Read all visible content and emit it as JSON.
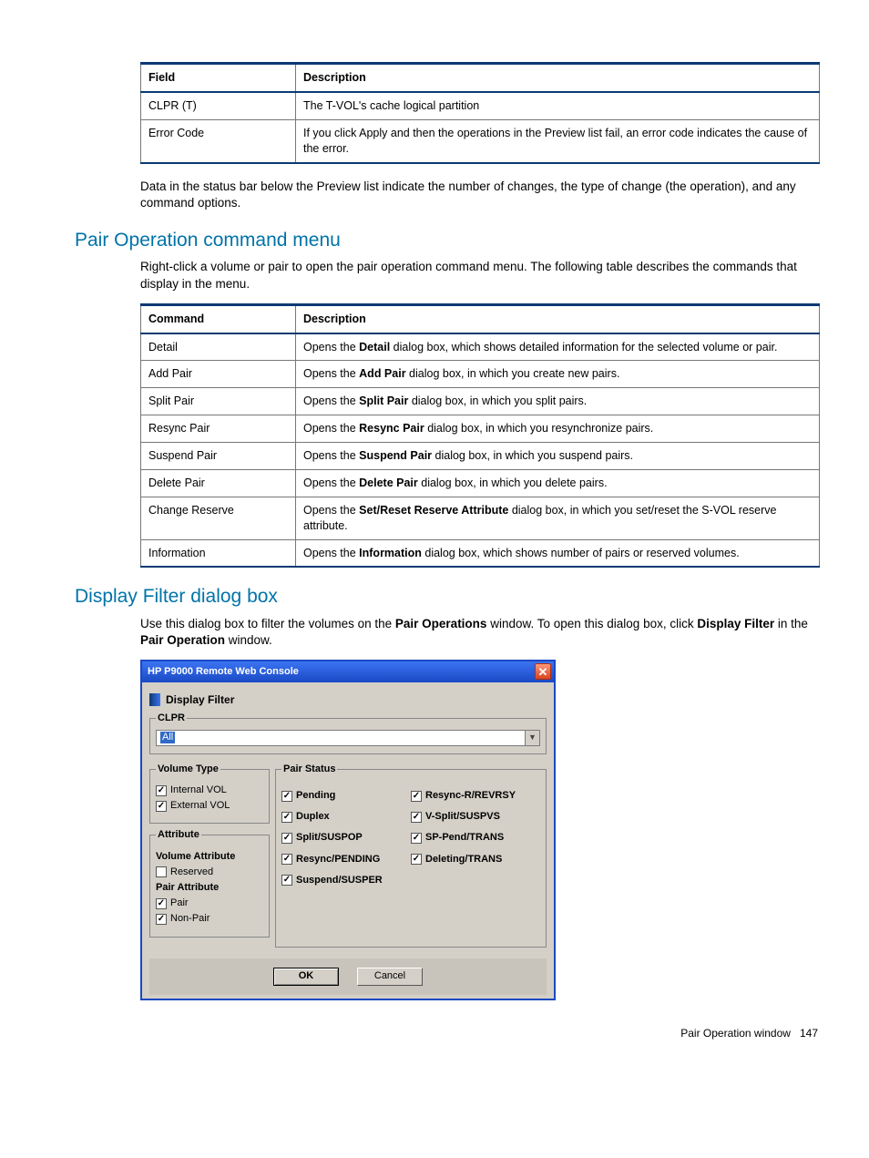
{
  "table1": {
    "headers": {
      "c1": "Field",
      "c2": "Description"
    },
    "rows": [
      {
        "c1": "CLPR (T)",
        "c2": "The T-VOL's cache logical partition"
      },
      {
        "c1": "Error Code",
        "c2": "If you click Apply and then the operations in the Preview list fail, an error code indicates the cause of the error."
      }
    ]
  },
  "para_after_t1": "Data in the status bar below the Preview list indicate the number of changes, the type of change (the operation), and any command options.",
  "section1_title": "Pair Operation command menu",
  "section1_intro": "Right-click a volume or pair to open the pair operation command menu. The following table describes the commands that display in the menu.",
  "table2": {
    "headers": {
      "c1": "Command",
      "c2": "Description"
    },
    "rows": [
      {
        "c1": "Detail",
        "pre": "Opens the ",
        "b": "Detail",
        "post": " dialog box, which shows detailed information for the selected volume or pair."
      },
      {
        "c1": "Add Pair",
        "pre": "Opens the ",
        "b": "Add Pair",
        "post": " dialog box, in which you create new pairs."
      },
      {
        "c1": "Split Pair",
        "pre": "Opens the ",
        "b": "Split Pair",
        "post": " dialog box, in which you split pairs."
      },
      {
        "c1": "Resync Pair",
        "pre": "Opens the ",
        "b": "Resync Pair",
        "post": " dialog box, in which you resynchronize pairs."
      },
      {
        "c1": "Suspend Pair",
        "pre": "Opens the ",
        "b": "Suspend Pair",
        "post": " dialog box, in which you suspend pairs."
      },
      {
        "c1": "Delete Pair",
        "pre": "Opens the ",
        "b": "Delete Pair",
        "post": " dialog box, in which you delete pairs."
      },
      {
        "c1": "Change Reserve",
        "pre": "Opens the ",
        "b": "Set/Reset Reserve Attribute",
        "post": " dialog box, in which you set/reset the S-VOL reserve attribute."
      },
      {
        "c1": "Information",
        "pre": "Opens the ",
        "b": "Information",
        "post": " dialog box, which shows number of pairs or reserved volumes."
      }
    ]
  },
  "section2_title": "Display Filter dialog box",
  "section2_intro": {
    "p1a": "Use this dialog box to filter the volumes on the ",
    "p1b": "Pair Operations",
    "p1c": " window. To open this dialog box, click ",
    "p1d": "Display Filter",
    "p1e": " in the ",
    "p1f": "Pair Operation",
    "p1g": " window."
  },
  "dialog": {
    "titlebar": "HP P9000 Remote Web Console",
    "tab": "Display Filter",
    "clpr": {
      "legend": "CLPR",
      "value": "All"
    },
    "voltype": {
      "legend": "Volume Type",
      "internal": "Internal VOL",
      "external": "External VOL"
    },
    "attribute": {
      "legend": "Attribute",
      "vol_attr_label": "Volume Attribute",
      "reserved": "Reserved",
      "pair_attr_label": "Pair Attribute",
      "pair": "Pair",
      "nonpair": "Non-Pair"
    },
    "pairstatus": {
      "legend": "Pair Status",
      "left": [
        "Pending",
        "Duplex",
        "Split/SUSPOP",
        "Resync/PENDING",
        "Suspend/SUSPER"
      ],
      "right": [
        "Resync-R/REVRSY",
        "V-Split/SUSPVS",
        "SP-Pend/TRANS",
        "Deleting/TRANS"
      ]
    },
    "buttons": {
      "ok": "OK",
      "cancel": "Cancel"
    }
  },
  "footer": {
    "label": "Pair Operation window",
    "page": "147"
  }
}
